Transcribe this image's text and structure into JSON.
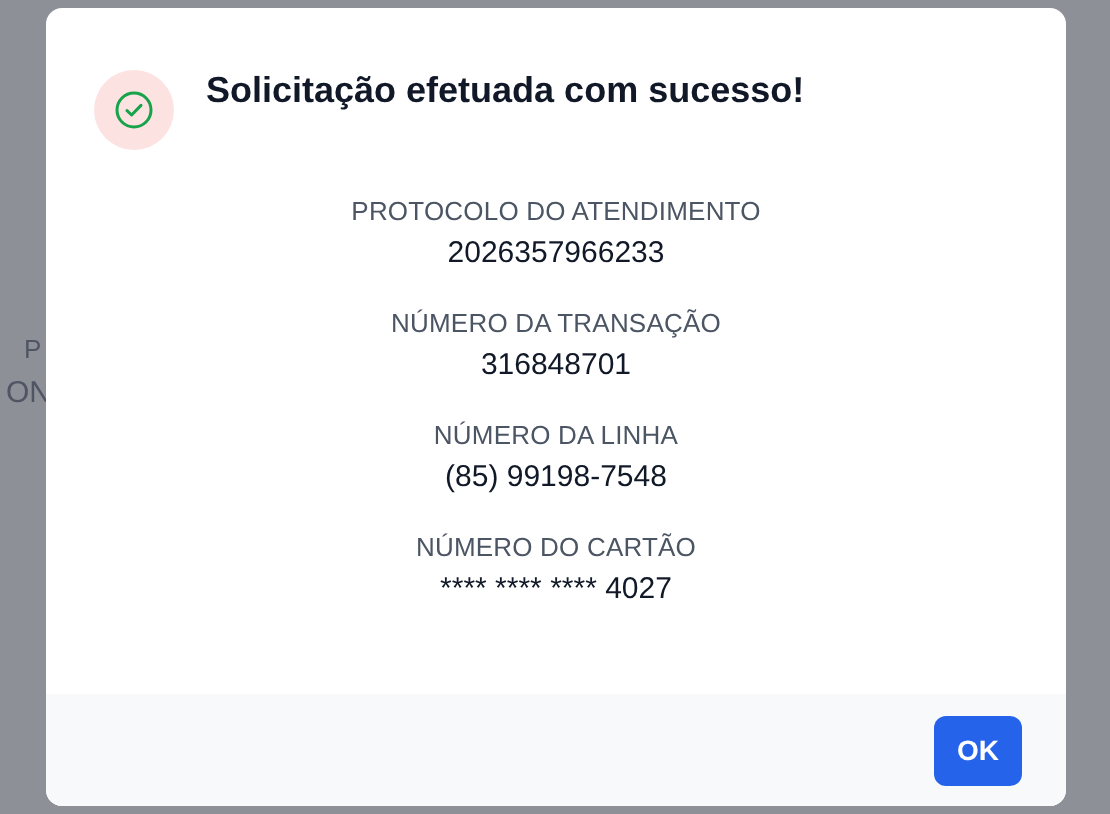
{
  "background": {
    "label_fragment": "P",
    "value_fragment": "ON"
  },
  "dialog": {
    "title": "Solicitação efetuada com sucesso!",
    "fields": [
      {
        "label": "PROTOCOLO DO ATENDIMENTO",
        "value": "2026357966233"
      },
      {
        "label": "NÚMERO DA TRANSAÇÃO",
        "value": "316848701"
      },
      {
        "label": "NÚMERO DA LINHA",
        "value": "(85) 99198-7548"
      },
      {
        "label": "NÚMERO DO CARTÃO",
        "value": "**** **** **** 4027"
      }
    ],
    "buttons": [
      "OK"
    ]
  }
}
